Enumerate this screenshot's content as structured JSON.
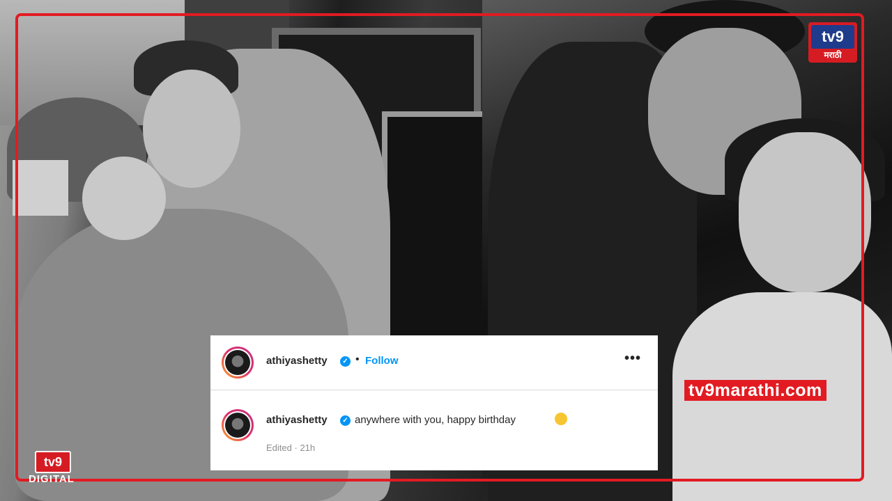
{
  "post": {
    "username": "athiyashetty",
    "follow_label": "Follow",
    "separator": "•",
    "more_label": "•••",
    "verified_mark": "✓",
    "caption": "anywhere with you, happy birthday",
    "emoji": "smiling-face-with-hearts",
    "edited_label": "Edited",
    "time_ago": "21h",
    "meta_separator": " · "
  },
  "branding": {
    "top_logo_text": "tv9",
    "top_logo_sub": "मराठी",
    "bottom_logo_text": "tv9",
    "bottom_logo_sub": "DIGITAL",
    "watermark": "tv9marathi.com"
  },
  "colors": {
    "frame_red": "#e21b22",
    "ig_blue": "#0095f6",
    "tv9_blue": "#1f3b8c"
  }
}
